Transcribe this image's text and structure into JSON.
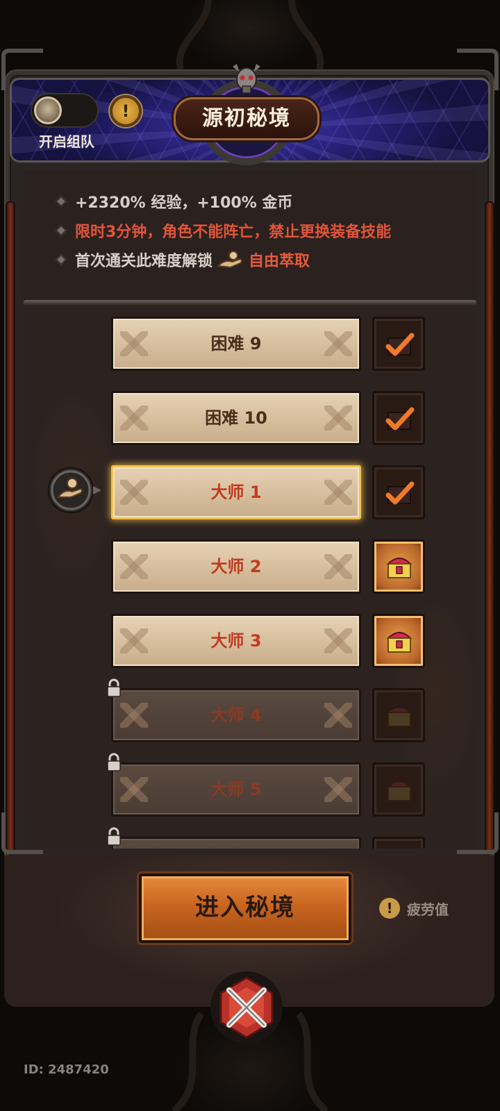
{
  "header": {
    "title": "源初秘境",
    "team_toggle": {
      "label": "开启组队",
      "enabled": false
    },
    "info_icon": "exclamation-icon"
  },
  "info": {
    "line1": "+2320% 经验，+100% 金币",
    "line2": "限时3分钟，角色不能阵亡，禁止更换装备技能",
    "line3_prefix": "首次通关此难度解锁",
    "line3_unlock": "自由萃取"
  },
  "levels": [
    {
      "label": "困难 9",
      "tier": "hard",
      "state": "cleared",
      "reward": "claimed"
    },
    {
      "label": "困难 10",
      "tier": "hard",
      "state": "cleared",
      "reward": "claimed"
    },
    {
      "label": "大师 1",
      "tier": "master",
      "state": "selected",
      "reward": "claimed"
    },
    {
      "label": "大师 2",
      "tier": "master",
      "state": "open",
      "reward": "available"
    },
    {
      "label": "大师 3",
      "tier": "master",
      "state": "open",
      "reward": "available"
    },
    {
      "label": "大师 4",
      "tier": "master",
      "state": "locked",
      "reward": "locked"
    },
    {
      "label": "大师 5",
      "tier": "master",
      "state": "locked",
      "reward": "locked"
    },
    {
      "label": "",
      "tier": "master",
      "state": "locked",
      "reward": "locked"
    }
  ],
  "enter_button": "进入秘境",
  "fatigue": {
    "label": "疲劳值",
    "icon": "exclamation-icon"
  },
  "user_id": "ID: 2487420",
  "colors": {
    "accent_orange": "#c9651f",
    "hard_text": "#4a2e1a",
    "master_text": "#c23a1e",
    "warning_red": "#e2543a",
    "banner_blue": "#3b34a8"
  }
}
